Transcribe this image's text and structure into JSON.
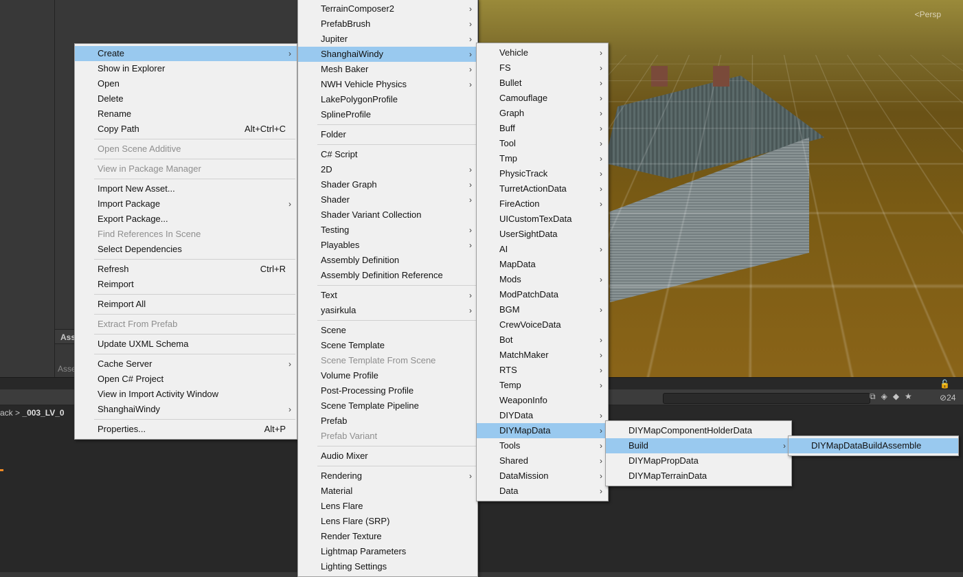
{
  "scene": {
    "view_mode": "Persp",
    "breadcrumb_prefix": "ack",
    "breadcrumb_item": "_003_LV_0",
    "hidden_count": "24",
    "asset_tab": "Ass",
    "asset_label": "Asse"
  },
  "menus": {
    "main": [
      {
        "label": "Create",
        "highlight": true,
        "submenu": true
      },
      {
        "label": "Show in Explorer"
      },
      {
        "label": "Open"
      },
      {
        "label": "Delete"
      },
      {
        "label": "Rename"
      },
      {
        "label": "Copy Path",
        "shortcut": "Alt+Ctrl+C"
      },
      {
        "sep": true
      },
      {
        "label": "Open Scene Additive",
        "disabled": true
      },
      {
        "sep": true
      },
      {
        "label": "View in Package Manager",
        "disabled": true
      },
      {
        "sep": true
      },
      {
        "label": "Import New Asset..."
      },
      {
        "label": "Import Package",
        "submenu": true
      },
      {
        "label": "Export Package..."
      },
      {
        "label": "Find References In Scene",
        "disabled": true
      },
      {
        "label": "Select Dependencies"
      },
      {
        "sep": true
      },
      {
        "label": "Refresh",
        "shortcut": "Ctrl+R"
      },
      {
        "label": "Reimport"
      },
      {
        "sep": true
      },
      {
        "label": "Reimport All"
      },
      {
        "sep": true
      },
      {
        "label": "Extract From Prefab",
        "disabled": true
      },
      {
        "sep": true
      },
      {
        "label": "Update UXML Schema"
      },
      {
        "sep": true
      },
      {
        "label": "Cache Server",
        "submenu": true
      },
      {
        "label": "Open C# Project"
      },
      {
        "label": "View in Import Activity Window"
      },
      {
        "label": "ShanghaiWindy",
        "submenu": true
      },
      {
        "sep": true
      },
      {
        "label": "Properties...",
        "shortcut": "Alt+P"
      }
    ],
    "create": [
      {
        "label": "TerrainComposer2",
        "submenu": true
      },
      {
        "label": "PrefabBrush",
        "submenu": true
      },
      {
        "label": "Jupiter",
        "submenu": true
      },
      {
        "label": "ShanghaiWindy",
        "highlight": true,
        "submenu": true
      },
      {
        "label": "Mesh Baker",
        "submenu": true
      },
      {
        "label": "NWH Vehicle Physics",
        "submenu": true
      },
      {
        "label": "LakePolygonProfile"
      },
      {
        "label": "SplineProfile"
      },
      {
        "sep": true
      },
      {
        "label": "Folder"
      },
      {
        "sep": true
      },
      {
        "label": "C# Script"
      },
      {
        "label": "2D",
        "submenu": true
      },
      {
        "label": "Shader Graph",
        "submenu": true
      },
      {
        "label": "Shader",
        "submenu": true
      },
      {
        "label": "Shader Variant Collection"
      },
      {
        "label": "Testing",
        "submenu": true
      },
      {
        "label": "Playables",
        "submenu": true
      },
      {
        "label": "Assembly Definition"
      },
      {
        "label": "Assembly Definition Reference"
      },
      {
        "sep": true
      },
      {
        "label": "Text",
        "submenu": true
      },
      {
        "label": "yasirkula",
        "submenu": true
      },
      {
        "sep": true
      },
      {
        "label": "Scene"
      },
      {
        "label": "Scene Template"
      },
      {
        "label": "Scene Template From Scene",
        "disabled": true
      },
      {
        "label": "Volume Profile"
      },
      {
        "label": "Post-Processing Profile"
      },
      {
        "label": "Scene Template Pipeline"
      },
      {
        "label": "Prefab"
      },
      {
        "label": "Prefab Variant",
        "disabled": true
      },
      {
        "sep": true
      },
      {
        "label": "Audio Mixer"
      },
      {
        "sep": true
      },
      {
        "label": "Rendering",
        "submenu": true
      },
      {
        "label": "Material"
      },
      {
        "label": "Lens Flare"
      },
      {
        "label": "Lens Flare (SRP)"
      },
      {
        "label": "Render Texture"
      },
      {
        "label": "Lightmap Parameters"
      },
      {
        "label": "Lighting Settings"
      }
    ],
    "shanghaiwindy": [
      {
        "label": "Vehicle",
        "submenu": true
      },
      {
        "label": "FS",
        "submenu": true
      },
      {
        "label": "Bullet",
        "submenu": true
      },
      {
        "label": "Camouflage",
        "submenu": true
      },
      {
        "label": "Graph",
        "submenu": true
      },
      {
        "label": "Buff",
        "submenu": true
      },
      {
        "label": "Tool",
        "submenu": true
      },
      {
        "label": "Tmp",
        "submenu": true
      },
      {
        "label": "PhysicTrack",
        "submenu": true
      },
      {
        "label": "TurretActionData",
        "submenu": true
      },
      {
        "label": "FireAction",
        "submenu": true
      },
      {
        "label": "UICustomTexData"
      },
      {
        "label": "UserSightData"
      },
      {
        "label": "AI",
        "submenu": true
      },
      {
        "label": "MapData"
      },
      {
        "label": "Mods",
        "submenu": true
      },
      {
        "label": "ModPatchData"
      },
      {
        "label": "BGM",
        "submenu": true
      },
      {
        "label": "CrewVoiceData"
      },
      {
        "label": "Bot",
        "submenu": true
      },
      {
        "label": "MatchMaker",
        "submenu": true
      },
      {
        "label": "RTS",
        "submenu": true
      },
      {
        "label": "Temp",
        "submenu": true
      },
      {
        "label": "WeaponInfo"
      },
      {
        "label": "DIYData",
        "submenu": true
      },
      {
        "label": "DIYMapData",
        "highlight": true,
        "submenu": true
      },
      {
        "label": "Tools",
        "submenu": true
      },
      {
        "label": "Shared",
        "submenu": true
      },
      {
        "label": "DataMission",
        "submenu": true
      },
      {
        "label": "Data",
        "submenu": true
      }
    ],
    "diymapdata": [
      {
        "label": "DIYMapComponentHolderData"
      },
      {
        "label": "Build",
        "highlight": true,
        "submenu": true
      },
      {
        "label": "DIYMapPropData"
      },
      {
        "label": "DIYMapTerrainData"
      }
    ],
    "build": [
      {
        "label": "DIYMapDataBuildAssemble",
        "highlight": true
      }
    ]
  },
  "colors": {
    "menu_bg": "#f0f0f0",
    "menu_highlight": "#99c9ef",
    "disabled_text": "#8e8e8e",
    "editor_bg": "#383838"
  }
}
